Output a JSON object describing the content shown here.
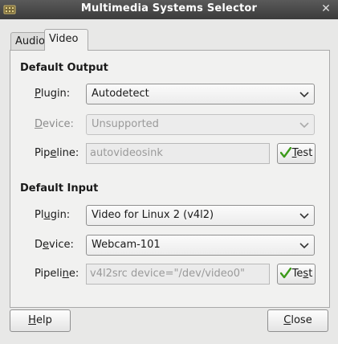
{
  "window": {
    "title": "Multimedia Systems Selector"
  },
  "tabs": [
    {
      "label": "Audio",
      "active": false
    },
    {
      "label": "Video",
      "active": true
    }
  ],
  "default_output": {
    "title": "Default Output",
    "plugin": {
      "label_pre": "",
      "label_u": "P",
      "label_post": "lugin:",
      "value": "Autodetect"
    },
    "device": {
      "label_pre": "",
      "label_u": "D",
      "label_post": "evice:",
      "value": "Unsupported",
      "disabled": true
    },
    "pipeline": {
      "label_pre": "Pip",
      "label_u": "e",
      "label_post": "line:",
      "value": "autovideosink"
    },
    "test_button": {
      "label_u": "T",
      "label_post": "est"
    }
  },
  "default_input": {
    "title": "Default Input",
    "plugin": {
      "label_pre": "Pl",
      "label_u": "u",
      "label_post": "gin:",
      "value": "Video for Linux 2 (v4l2)"
    },
    "device": {
      "label_pre": "D",
      "label_u": "e",
      "label_post": "vice:",
      "value": "Webcam-101"
    },
    "pipeline": {
      "label_pre": "Pipeli",
      "label_u": "n",
      "label_post": "e:",
      "value": "v4l2src device=\"/dev/video0\""
    },
    "test_button": {
      "label_pre": "Te",
      "label_u": "s",
      "label_post": "t"
    }
  },
  "buttons": {
    "help": {
      "label_u": "H",
      "label_post": "elp"
    },
    "close": {
      "label_u": "C",
      "label_post": "lose"
    }
  },
  "colors": {
    "titlebar": "#3b3b3b",
    "check": "#3c9a1a"
  }
}
